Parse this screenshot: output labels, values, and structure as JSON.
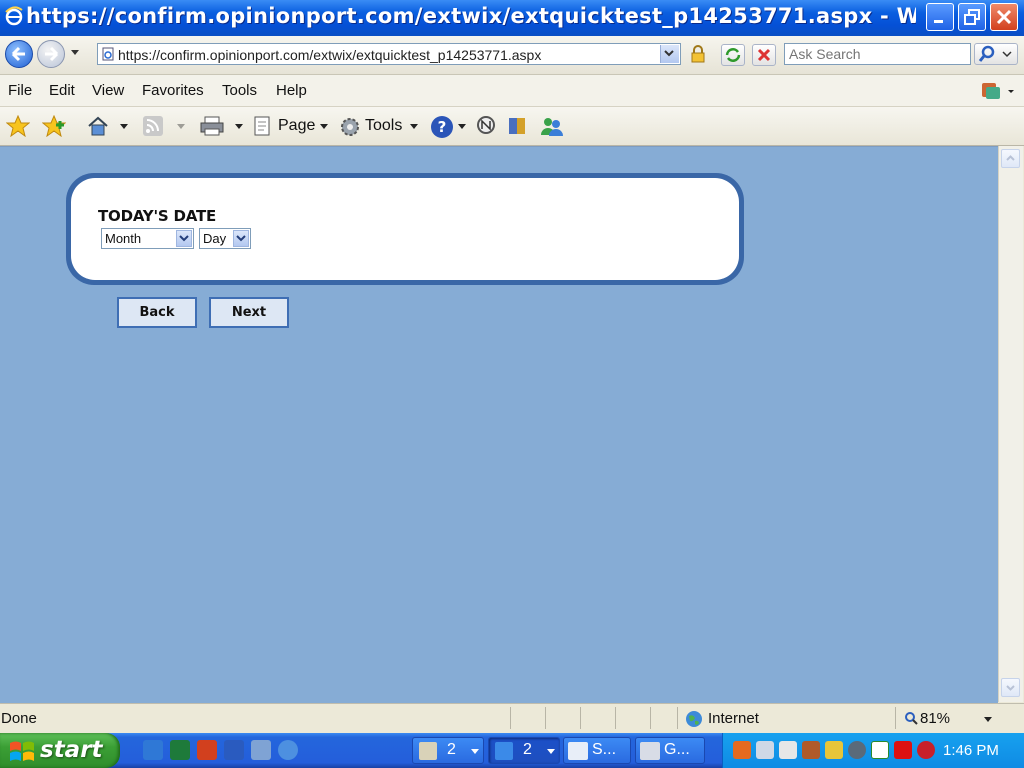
{
  "window": {
    "title": "https://confirm.opinionport.com/extwix/extquicktest_p14253771.aspx - Wi..."
  },
  "navbar": {
    "address": "https://confirm.opinionport.com/extwix/extquicktest_p14253771.aspx",
    "search_placeholder": "Ask Search"
  },
  "menubar": {
    "items": [
      "File",
      "Edit",
      "View",
      "Favorites",
      "Tools",
      "Help"
    ]
  },
  "commandbar": {
    "page_label": "Page",
    "tools_label": "Tools"
  },
  "form": {
    "heading": "TODAY'S DATE",
    "month_select": "Month",
    "day_select": "Day",
    "back_label": "Back",
    "next_label": "Next"
  },
  "statusbar": {
    "status": "Done",
    "zone": "Internet",
    "zoom": "81%"
  },
  "taskbar": {
    "start_label": "start",
    "tasks": [
      {
        "label": "2"
      },
      {
        "label": "2"
      },
      {
        "label": "S..."
      },
      {
        "label": "G..."
      }
    ],
    "clock": "1:46 PM"
  }
}
